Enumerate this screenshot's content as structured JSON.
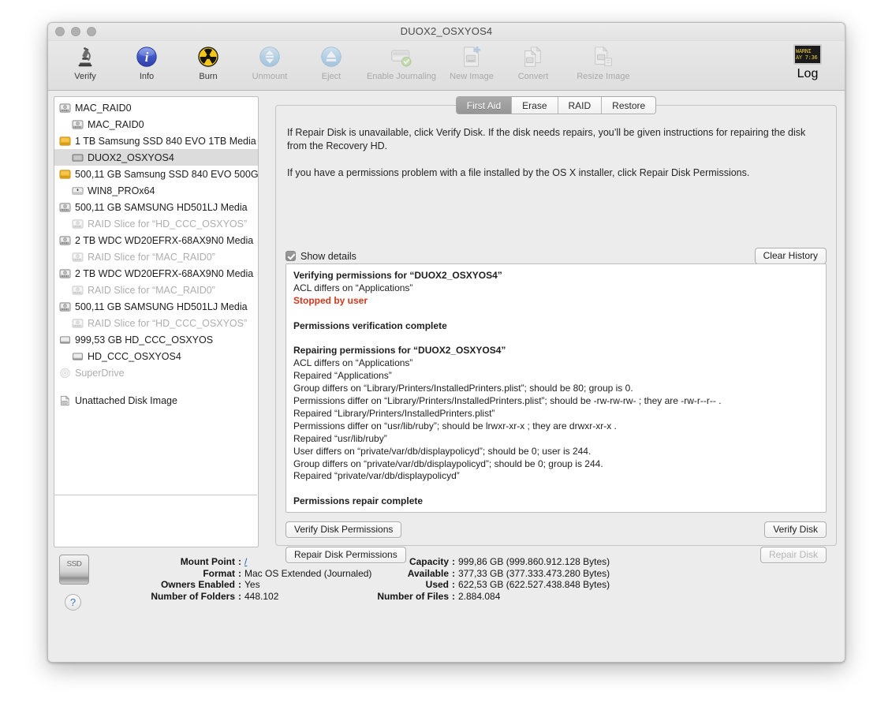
{
  "window": {
    "title": "DUOX2_OSXYOS4",
    "traffic_lights": [
      "close-button",
      "minimize-button",
      "zoom-button"
    ]
  },
  "toolbar": {
    "items": [
      {
        "label": "Verify",
        "icon": "microscope-icon",
        "enabled": true
      },
      {
        "label": "Info",
        "icon": "info-icon",
        "enabled": true
      },
      {
        "label": "Burn",
        "icon": "burn-icon",
        "enabled": true
      },
      {
        "label": "Unmount",
        "icon": "unmount-icon",
        "enabled": false
      },
      {
        "label": "Eject",
        "icon": "eject-icon",
        "enabled": false
      },
      {
        "label": "Enable Journaling",
        "icon": "journaling-icon",
        "enabled": false
      },
      {
        "label": "New Image",
        "icon": "new-image-icon",
        "enabled": false
      },
      {
        "label": "Convert",
        "icon": "convert-icon",
        "enabled": false
      },
      {
        "label": "Resize Image",
        "icon": "resize-image-icon",
        "enabled": false
      }
    ],
    "log": {
      "label": "Log",
      "icon": "log-icon",
      "glyph_line1": "WARNI",
      "glyph_line2": "AY 7:36"
    }
  },
  "sidebar": {
    "devices": [
      {
        "label": "MAC_RAID0",
        "icon": "hard-disk-icon",
        "indent": 0,
        "dim": false,
        "selected": false
      },
      {
        "label": "MAC_RAID0",
        "icon": "hard-disk-icon",
        "indent": 1,
        "dim": false,
        "selected": false
      },
      {
        "label": "1 TB Samsung SSD 840 EVO 1TB Media",
        "icon": "ssd-disk-icon",
        "indent": 0,
        "dim": false,
        "selected": false
      },
      {
        "label": "DUOX2_OSXYOS4",
        "icon": "volume-icon",
        "indent": 1,
        "dim": false,
        "selected": true
      },
      {
        "label": "500,11 GB Samsung SSD 840 EVO 500G",
        "icon": "ssd-disk-icon",
        "indent": 0,
        "dim": false,
        "selected": false
      },
      {
        "label": "WIN8_PROx64",
        "icon": "windows-volume-icon",
        "indent": 1,
        "dim": false,
        "selected": false
      },
      {
        "label": "500,11 GB SAMSUNG HD501LJ Media",
        "icon": "hard-disk-icon",
        "indent": 0,
        "dim": false,
        "selected": false
      },
      {
        "label": "RAID Slice for “HD_CCC_OSXYOS”",
        "icon": "hard-disk-icon",
        "indent": 1,
        "dim": true,
        "selected": false
      },
      {
        "label": "2 TB WDC WD20EFRX-68AX9N0 Media",
        "icon": "hard-disk-icon",
        "indent": 0,
        "dim": false,
        "selected": false
      },
      {
        "label": "RAID Slice for “MAC_RAID0”",
        "icon": "hard-disk-icon",
        "indent": 1,
        "dim": true,
        "selected": false
      },
      {
        "label": "2 TB WDC WD20EFRX-68AX9N0 Media",
        "icon": "hard-disk-icon",
        "indent": 0,
        "dim": false,
        "selected": false
      },
      {
        "label": "RAID Slice for “MAC_RAID0”",
        "icon": "hard-disk-icon",
        "indent": 1,
        "dim": true,
        "selected": false
      },
      {
        "label": "500,11 GB SAMSUNG HD501LJ Media",
        "icon": "hard-disk-icon",
        "indent": 0,
        "dim": false,
        "selected": false
      },
      {
        "label": "RAID Slice for “HD_CCC_OSXYOS”",
        "icon": "hard-disk-icon",
        "indent": 1,
        "dim": true,
        "selected": false
      },
      {
        "label": "999,53 GB HD_CCC_OSXYOS",
        "icon": "external-disk-icon",
        "indent": 0,
        "dim": false,
        "selected": false
      },
      {
        "label": "HD_CCC_OSXYOS4",
        "icon": "external-disk-icon",
        "indent": 1,
        "dim": false,
        "selected": false
      },
      {
        "label": "SuperDrive",
        "icon": "optical-drive-icon",
        "indent": 0,
        "dim": true,
        "selected": false
      }
    ],
    "unattached": {
      "label": "Unattached Disk Image",
      "icon": "disk-image-icon"
    }
  },
  "main": {
    "tabs": [
      {
        "label": "First Aid",
        "active": true
      },
      {
        "label": "Erase",
        "active": false
      },
      {
        "label": "RAID",
        "active": false
      },
      {
        "label": "Restore",
        "active": false
      }
    ],
    "help_paragraph_1": "If Repair Disk is unavailable, click Verify Disk. If the disk needs repairs, you’ll be given instructions for repairing the disk from the Recovery HD.",
    "help_paragraph_2": "If you have a permissions problem with a file installed by the OS X installer, click Repair Disk Permissions.",
    "show_details_label": "Show details",
    "show_details_checked": true,
    "clear_history_label": "Clear History",
    "log_lines": [
      {
        "text": "Verifying permissions for “DUOX2_OSXYOS4”",
        "style": "bold"
      },
      {
        "text": "ACL differs on “Applications”",
        "style": "normal"
      },
      {
        "text": "Stopped by user",
        "style": "error"
      },
      {
        "text": "",
        "style": "blank"
      },
      {
        "text": "Permissions verification complete",
        "style": "bold"
      },
      {
        "text": "",
        "style": "blank"
      },
      {
        "text": "Repairing permissions for “DUOX2_OSXYOS4”",
        "style": "bold"
      },
      {
        "text": "ACL differs on “Applications”",
        "style": "normal"
      },
      {
        "text": "Repaired “Applications”",
        "style": "normal"
      },
      {
        "text": "Group differs on “Library/Printers/InstalledPrinters.plist”; should be 80; group is 0.",
        "style": "normal"
      },
      {
        "text": "Permissions differ on “Library/Printers/InstalledPrinters.plist”; should be -rw-rw-rw- ; they are -rw-r--r-- .",
        "style": "normal"
      },
      {
        "text": "Repaired “Library/Printers/InstalledPrinters.plist”",
        "style": "normal"
      },
      {
        "text": "Permissions differ on “usr/lib/ruby”; should be lrwxr-xr-x ; they are drwxr-xr-x .",
        "style": "normal"
      },
      {
        "text": "Repaired “usr/lib/ruby”",
        "style": "normal"
      },
      {
        "text": "User differs on “private/var/db/displaypolicyd”; should be 0; user is 244.",
        "style": "normal"
      },
      {
        "text": "Group differs on “private/var/db/displaypolicyd”; should be 0; group is 244.",
        "style": "normal"
      },
      {
        "text": "Repaired “private/var/db/displaypolicyd”",
        "style": "normal"
      },
      {
        "text": "",
        "style": "blank"
      },
      {
        "text": "Permissions repair complete",
        "style": "bold"
      }
    ],
    "buttons": {
      "verify_disk_permissions": {
        "label": "Verify Disk Permissions",
        "enabled": true
      },
      "repair_disk_permissions": {
        "label": "Repair Disk Permissions",
        "enabled": true
      },
      "verify_disk": {
        "label": "Verify Disk",
        "enabled": true
      },
      "repair_disk": {
        "label": "Repair Disk",
        "enabled": false
      }
    }
  },
  "footer": {
    "disk_icon_label": "SSD",
    "help_button_label": "?",
    "left_column": [
      {
        "label": "Mount Point",
        "value": "/",
        "is_link": true
      },
      {
        "label": "Format",
        "value": "Mac OS Extended (Journaled)",
        "is_link": false
      },
      {
        "label": "Owners Enabled",
        "value": "Yes",
        "is_link": false
      },
      {
        "label": "Number of Folders",
        "value": "448.102",
        "is_link": false
      }
    ],
    "right_column": [
      {
        "label": "Capacity",
        "value": "999,86 GB (999.860.912.128 Bytes)",
        "is_link": false
      },
      {
        "label": "Available",
        "value": "377,33 GB (377.333.473.280 Bytes)",
        "is_link": false
      },
      {
        "label": "Used",
        "value": "622,53 GB (622.527.438.848 Bytes)",
        "is_link": false
      },
      {
        "label": "Number of Files",
        "value": "2.884.084",
        "is_link": false
      }
    ],
    "separator": ":"
  },
  "colors": {
    "accent_link": "#2a5db0",
    "error_text": "#d1381e",
    "selected_row": "#dcdcdc",
    "ssd_icon": "#f0b429",
    "window_bg": "#ececec"
  }
}
